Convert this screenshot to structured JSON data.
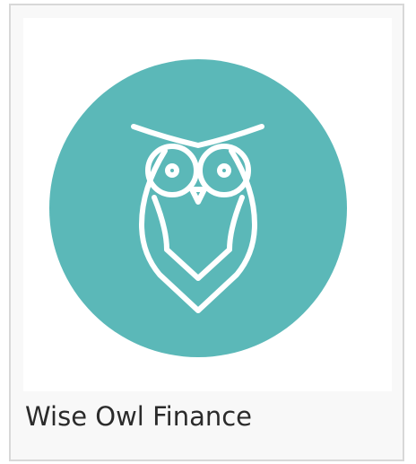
{
  "card": {
    "title": "Wise Owl Finance"
  },
  "logo": {
    "icon": "owl-logo-icon",
    "circle_color": "#5bb8b8",
    "line_color": "#ffffff"
  }
}
